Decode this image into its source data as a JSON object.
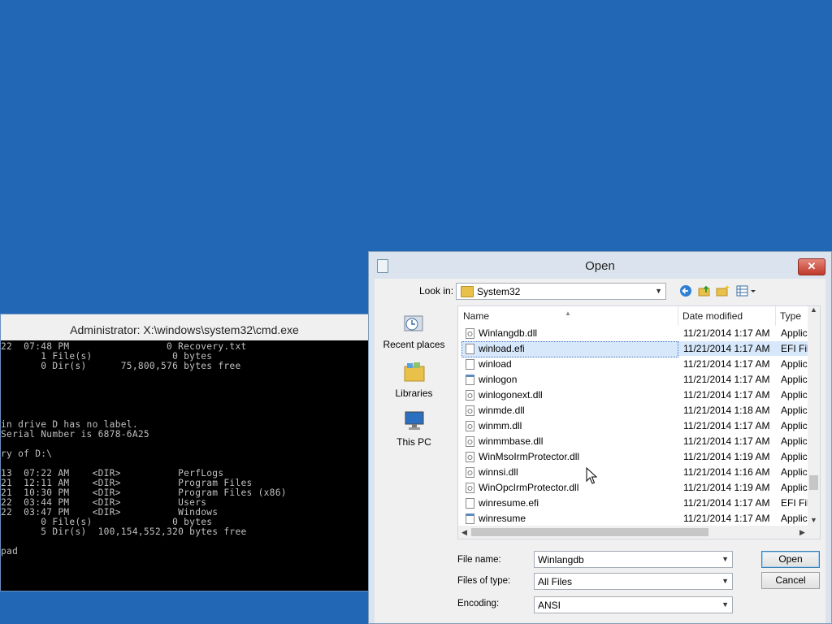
{
  "cmd": {
    "title": "Administrator: X:\\windows\\system32\\cmd.exe",
    "lines": [
      "22  07:48 PM                 0 Recovery.txt",
      "       1 File(s)              0 bytes",
      "       0 Dir(s)      75,800,576 bytes free",
      "",
      "",
      "",
      "",
      "",
      "in drive D has no label.",
      "Serial Number is 6878-6A25",
      "",
      "ry of D:\\",
      "",
      "13  07:22 AM    <DIR>          PerfLogs",
      "21  12:11 AM    <DIR>          Program Files",
      "21  10:30 PM    <DIR>          Program Files (x86)",
      "22  03:44 PM    <DIR>          Users",
      "22  03:47 PM    <DIR>          Windows",
      "       0 File(s)              0 bytes",
      "       5 Dir(s)  100,154,552,320 bytes free",
      "",
      "pad"
    ]
  },
  "dialog": {
    "title": "Open",
    "close_glyph": "✕",
    "look_in_label": "Look in:",
    "look_in_value": "System32",
    "places": [
      {
        "label": "Recent places",
        "icon": "recent-places-icon"
      },
      {
        "label": "Libraries",
        "icon": "libraries-icon"
      },
      {
        "label": "This PC",
        "icon": "this-pc-icon"
      }
    ],
    "columns": {
      "name": "Name",
      "date": "Date modified",
      "type": "Type"
    },
    "files": [
      {
        "name": "Winlangdb.dll",
        "date": "11/21/2014 1:17 AM",
        "type": "Applic",
        "icon": "dll-file-icon"
      },
      {
        "name": "winload.efi",
        "date": "11/21/2014 1:17 AM",
        "type": "EFI File",
        "icon": "file-icon"
      },
      {
        "name": "winload",
        "date": "11/21/2014 1:17 AM",
        "type": "Applic",
        "icon": "file-icon"
      },
      {
        "name": "winlogon",
        "date": "11/21/2014 1:17 AM",
        "type": "Applic",
        "icon": "exe-file-icon"
      },
      {
        "name": "winlogonext.dll",
        "date": "11/21/2014 1:17 AM",
        "type": "Applic",
        "icon": "dll-file-icon"
      },
      {
        "name": "winmde.dll",
        "date": "11/21/2014 1:18 AM",
        "type": "Applic",
        "icon": "dll-file-icon"
      },
      {
        "name": "winmm.dll",
        "date": "11/21/2014 1:17 AM",
        "type": "Applic",
        "icon": "dll-file-icon"
      },
      {
        "name": "winmmbase.dll",
        "date": "11/21/2014 1:17 AM",
        "type": "Applic",
        "icon": "dll-file-icon"
      },
      {
        "name": "WinMsoIrmProtector.dll",
        "date": "11/21/2014 1:19 AM",
        "type": "Applic",
        "icon": "dll-file-icon"
      },
      {
        "name": "winnsi.dll",
        "date": "11/21/2014 1:16 AM",
        "type": "Applic",
        "icon": "dll-file-icon"
      },
      {
        "name": "WinOpcIrmProtector.dll",
        "date": "11/21/2014 1:19 AM",
        "type": "Applic",
        "icon": "dll-file-icon"
      },
      {
        "name": "winresume.efi",
        "date": "11/21/2014 1:17 AM",
        "type": "EFI File",
        "icon": "file-icon"
      },
      {
        "name": "winresume",
        "date": "11/21/2014 1:17 AM",
        "type": "Applic",
        "icon": "exe-file-icon"
      }
    ],
    "selected_file": "winload.efi",
    "file_name_label": "File name:",
    "file_name_value": "Winlangdb",
    "files_of_type_label": "Files of type:",
    "files_of_type_value": "All Files",
    "encoding_label": "Encoding:",
    "encoding_value": "ANSI",
    "open_button": "Open",
    "cancel_button": "Cancel"
  },
  "colors": {
    "desktop": "#2167b5",
    "dialog_frame": "#dbe4ee",
    "close_button": "#c0392b",
    "selection": "#d8e8fb"
  }
}
